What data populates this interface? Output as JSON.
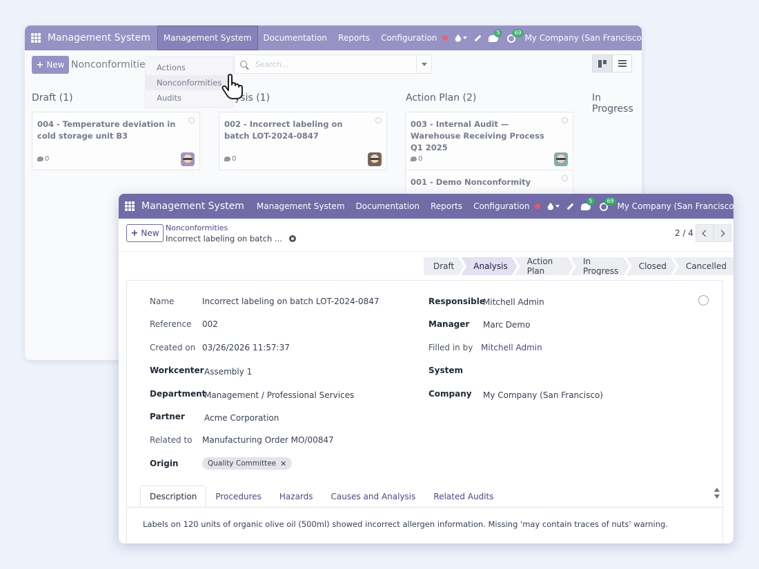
{
  "back": {
    "brand": "Management System",
    "menu": [
      "Management System",
      "Documentation",
      "Reports",
      "Configuration"
    ],
    "chat_badge": "5",
    "activity_badge": "69",
    "company": "My Company (San Francisco)",
    "new_label": "New",
    "title": "Nonconformities",
    "search_placeholder": "Search...",
    "dropdown": [
      "Actions",
      "Nonconformities",
      "Audits"
    ],
    "columns": [
      "Draft (1)",
      "ysis (1)",
      "Action Plan (2)",
      "In Progress"
    ],
    "cards": [
      {
        "title": "004 - Temperature deviation in cold storage unit B3",
        "count": "0"
      },
      {
        "title": "002 - Incorrect labeling on batch LOT-2024-0847",
        "count": "0"
      },
      {
        "title": "003 - Internal Audit — Warehouse Receiving Process Q1 2025",
        "count": "0"
      },
      {
        "title": "001 - Demo Nonconformity"
      }
    ]
  },
  "front": {
    "brand": "Management System",
    "menu": [
      "Management System",
      "Documentation",
      "Reports",
      "Configuration"
    ],
    "chat_badge": "5",
    "activity_badge": "69",
    "company": "My Company (San Francisco)",
    "new_label": "New",
    "breadcrumb_parent": "Nonconformities",
    "breadcrumb_current": "Incorrect labeling on batch ...",
    "pager": "2 / 4",
    "stages": [
      "Draft",
      "Analysis",
      "Action Plan",
      "In Progress",
      "Closed",
      "Cancelled"
    ],
    "current_stage": "Analysis",
    "fields_left": [
      {
        "label": "Name",
        "value": "Incorrect labeling on batch LOT-2024-0847"
      },
      {
        "label": "Reference",
        "value": "002"
      },
      {
        "label": "Created on",
        "value": "03/26/2026 11:57:37"
      },
      {
        "label": "Workcenter",
        "value": "Assembly 1"
      },
      {
        "label": "Department",
        "value": "Management / Professional Services"
      },
      {
        "label": "Partner",
        "value": "Acme Corporation"
      },
      {
        "label": "Related to",
        "value": "Manufacturing Order MO/00847"
      },
      {
        "label": "Origin"
      }
    ],
    "origin_tag": "Quality Committee",
    "fields_right": [
      {
        "label": "Responsible",
        "value": "Mitchell Admin"
      },
      {
        "label": "Manager",
        "value": "Marc Demo"
      },
      {
        "label": "Filled in by",
        "value": "Mitchell Admin"
      },
      {
        "label": "System",
        "value": ""
      },
      {
        "label": "Company",
        "value": "My Company (San Francisco)"
      }
    ],
    "tabs": [
      "Description",
      "Procedures",
      "Hazards",
      "Causes and Analysis",
      "Related Audits"
    ],
    "description": "Labels on 120 units of organic olive oil (500ml) showed incorrect allergen information. Missing 'may contain traces of nuts' warning."
  },
  "colors": {
    "navbar_back": "#8f8ac0",
    "navbar_front": "#716ba8",
    "accent_link": "#4b4786",
    "badge_green": "#3aa86b",
    "record_red": "#e05a6a"
  },
  "icons": [
    "apps-grid-icon",
    "record-dot-icon",
    "droplet-icon",
    "pencil-icon",
    "chat-icon",
    "clock-icon",
    "search-icon",
    "kanban-view-icon",
    "list-view-icon",
    "gear-icon",
    "chevron-left-icon",
    "chevron-right-icon",
    "hand-pointer-icon"
  ]
}
